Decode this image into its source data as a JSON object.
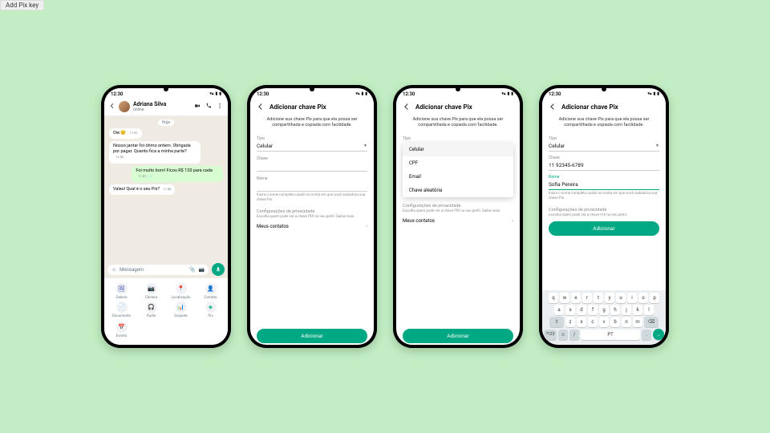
{
  "browser_tab": "Add Pix key",
  "statusbar": {
    "time": "12:30"
  },
  "phone1": {
    "contact_name": "Adriana Silva",
    "contact_status": "online",
    "day_label": "Hoje",
    "msg1": {
      "text": "Oie",
      "time": "11:51"
    },
    "msg2": {
      "text": "Nosso jantar foi ótimo ontem. Obrigada por pagar. Quanto fica a minha parte?",
      "time": "11:53"
    },
    "msg3": {
      "text": "Foi muito bom! Ficou R$ 120 para cada",
      "time": "11:57"
    },
    "msg4": {
      "text": "Valeu! Qual é o seu Pix?",
      "time": "11:58"
    },
    "input_placeholder": "Mensagem",
    "attachments": {
      "galeria": "Galeria",
      "camera": "Câmera",
      "localizacao": "Localização",
      "contato": "Contato",
      "documento": "Documento",
      "audio": "Áudio",
      "enquete": "Enquete",
      "pix": "Pix",
      "evento": "Evento"
    }
  },
  "phone2": {
    "title": "Adicionar chave Pix",
    "desc": "Adicione sua chave Pix para que ela possa ser compartilhada e copiada com facilidade.",
    "tipo_label": "Tipo",
    "tipo_value": "Celular",
    "chave_label": "Chave",
    "nome_label": "Nome",
    "nome_hint": "Insira o nome completo usado na conta em que você cadastrou sua chave Pix.",
    "privacy_title": "Configurações de privacidade",
    "privacy_desc": "Escolha quem pode ver a chave PIX no seu perfil. Saiba mais.",
    "contacts_label": "Meus contatos",
    "add_button": "Adicionar"
  },
  "phone3": {
    "title": "Adicionar chave Pix",
    "desc": "Adicione sua chave Pix para que ela possa ser compartilhada e copiada com facilidade.",
    "tipo_label": "Tipo",
    "dropdown": {
      "celular": "Celular",
      "cpf": "CPF",
      "email": "Email",
      "aleatoria": "Chave aleatória"
    },
    "privacy_title": "Configurações de privacidade",
    "privacy_desc": "Escolha quem pode ver a chave PIX no seu perfil. Saiba mais.",
    "contacts_label": "Meus contatos",
    "add_button": "Adicionar"
  },
  "phone4": {
    "title": "Adicionar chave Pix",
    "desc": "Adicione sua chave Pix para que ela possa ser compartilhada e copiada com facilidade.",
    "tipo_label": "Tipo",
    "tipo_value": "Celular",
    "chave_label": "Chave",
    "chave_value": "11 92345-6789",
    "nome_label": "Nome",
    "nome_value": "Sofia Pereira",
    "nome_hint": "Insira o nome completo usado na conta em que você cadastrou sua chave Pix.",
    "privacy_title": "Configurações de privacidade",
    "privacy_desc": "Escolha quem pode ver a chave PIX no seu perfil.",
    "add_button": "Adicionar",
    "keyboard": {
      "row1": [
        "q",
        "w",
        "e",
        "r",
        "t",
        "y",
        "u",
        "i",
        "o",
        "p"
      ],
      "row2": [
        "a",
        "s",
        "d",
        "f",
        "g",
        "h",
        "j",
        "k",
        "l"
      ],
      "row3": [
        "z",
        "x",
        "c",
        "v",
        "b",
        "n",
        "m"
      ],
      "shift": "⇧",
      "backspace": "⌫",
      "numbers": "?123",
      "emoji": "☺",
      "slash": "/",
      "lang": "PT",
      "period": "."
    }
  }
}
